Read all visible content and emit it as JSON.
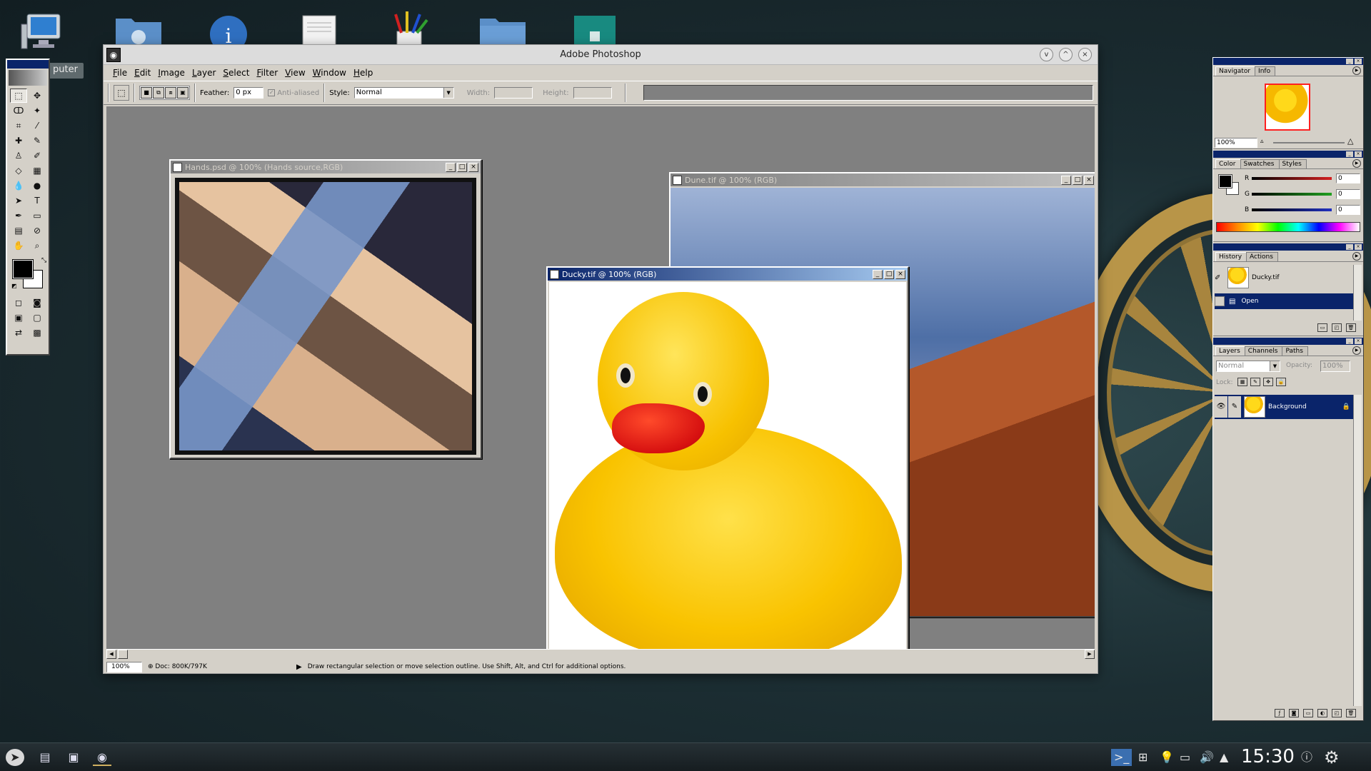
{
  "desktop": {
    "icons": [
      "computer-icon",
      "network-folder-icon",
      "info-icon",
      "document-icon",
      "graphics-app-icon",
      "folder-icon",
      "teal-book-icon"
    ],
    "label_partial": "puter"
  },
  "window": {
    "title": "Adobe Photoshop",
    "wm_buttons": [
      "v",
      "^",
      "×"
    ]
  },
  "menu": [
    "File",
    "Edit",
    "Image",
    "Layer",
    "Select",
    "Filter",
    "View",
    "Window",
    "Help"
  ],
  "options": {
    "feather_label": "Feather:",
    "feather_value": "0 px",
    "anti_aliased_label": "Anti-aliased",
    "style_label": "Style:",
    "style_value": "Normal",
    "width_label": "Width:",
    "height_label": "Height:"
  },
  "documents": {
    "hands": {
      "title": "Hands.psd @ 100% (Hands source,RGB)"
    },
    "dune": {
      "title": "Dune.tif @ 100% (RGB)"
    },
    "ducky": {
      "title": "Ducky.tif @ 100% (RGB)"
    }
  },
  "status": {
    "zoom": "100%",
    "doc_size": "Doc: 800K/797K",
    "hint": "Draw rectangular selection or move selection outline.  Use Shift, Alt, and Ctrl for additional options."
  },
  "palettes": {
    "navigator": {
      "tabs": [
        "Navigator",
        "Info"
      ],
      "zoom": "100%"
    },
    "color": {
      "tabs": [
        "Color",
        "Swatches",
        "Styles"
      ],
      "channels": [
        {
          "label": "R",
          "value": "0",
          "color": "#d42020"
        },
        {
          "label": "G",
          "value": "0",
          "color": "#20a020"
        },
        {
          "label": "B",
          "value": "0",
          "color": "#2030c0"
        }
      ]
    },
    "history": {
      "tabs": [
        "History",
        "Actions"
      ],
      "snapshot": "Ducky.tif",
      "state": "Open"
    },
    "layers": {
      "tabs": [
        "Layers",
        "Channels",
        "Paths"
      ],
      "blend_mode": "Normal",
      "opacity_label": "Opacity:",
      "opacity_value": "100%",
      "lock_label": "Lock:",
      "layer_name": "Background"
    }
  },
  "taskbar": {
    "clock": "15:30"
  },
  "colors": {
    "accent_titlebar": "#0a246a",
    "window_face": "#d4d0c8",
    "workspace": "#808080"
  }
}
